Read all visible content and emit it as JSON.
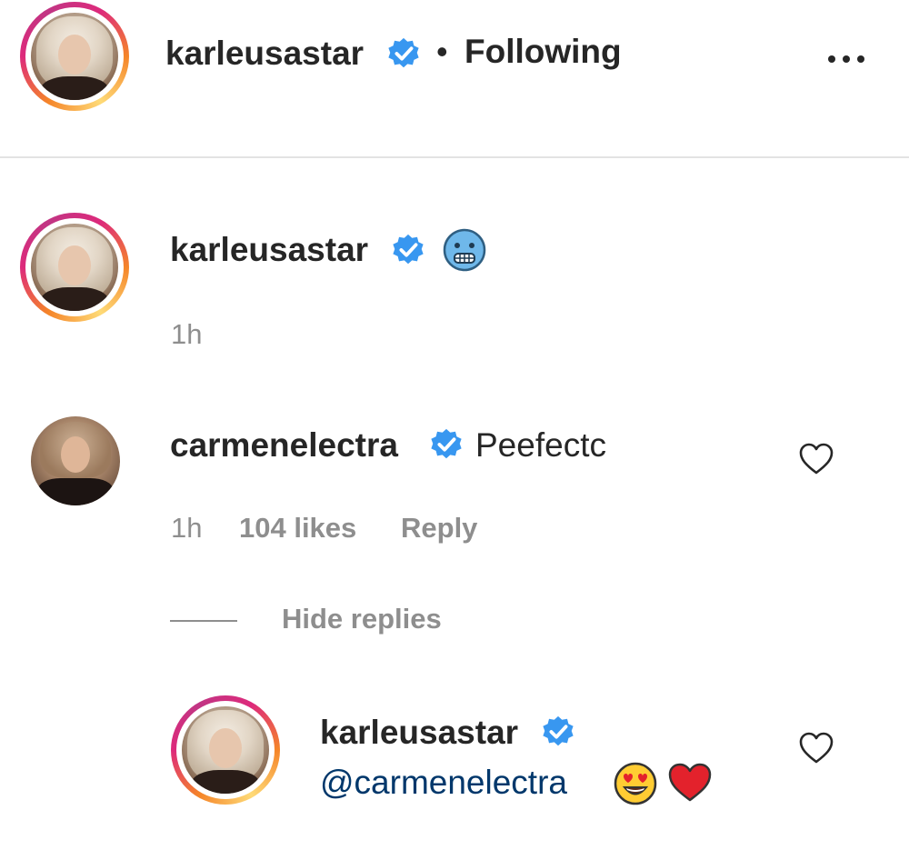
{
  "header": {
    "username": "karleusastar",
    "separator": "•",
    "follow_status": "Following",
    "more_icon": "more-horizontal-icon"
  },
  "comments": [
    {
      "username": "karleusastar",
      "text_icon": "cold-face-emoji",
      "time": "1h"
    },
    {
      "username": "carmenelectra",
      "text": "Peefectc",
      "time": "1h",
      "likes": "104 likes",
      "reply_label": "Reply",
      "hide_replies_label": "Hide replies",
      "replies": [
        {
          "username": "karleusastar",
          "mention": "@carmenelectra",
          "emojis": [
            "heart-eyes-emoji",
            "red-heart-emoji"
          ]
        }
      ]
    }
  ],
  "colors": {
    "verified_blue": "#3897f0",
    "text_primary": "#262626",
    "text_secondary": "#8e8e8e",
    "mention_blue": "#00376b",
    "divider": "#e3e3e3"
  }
}
